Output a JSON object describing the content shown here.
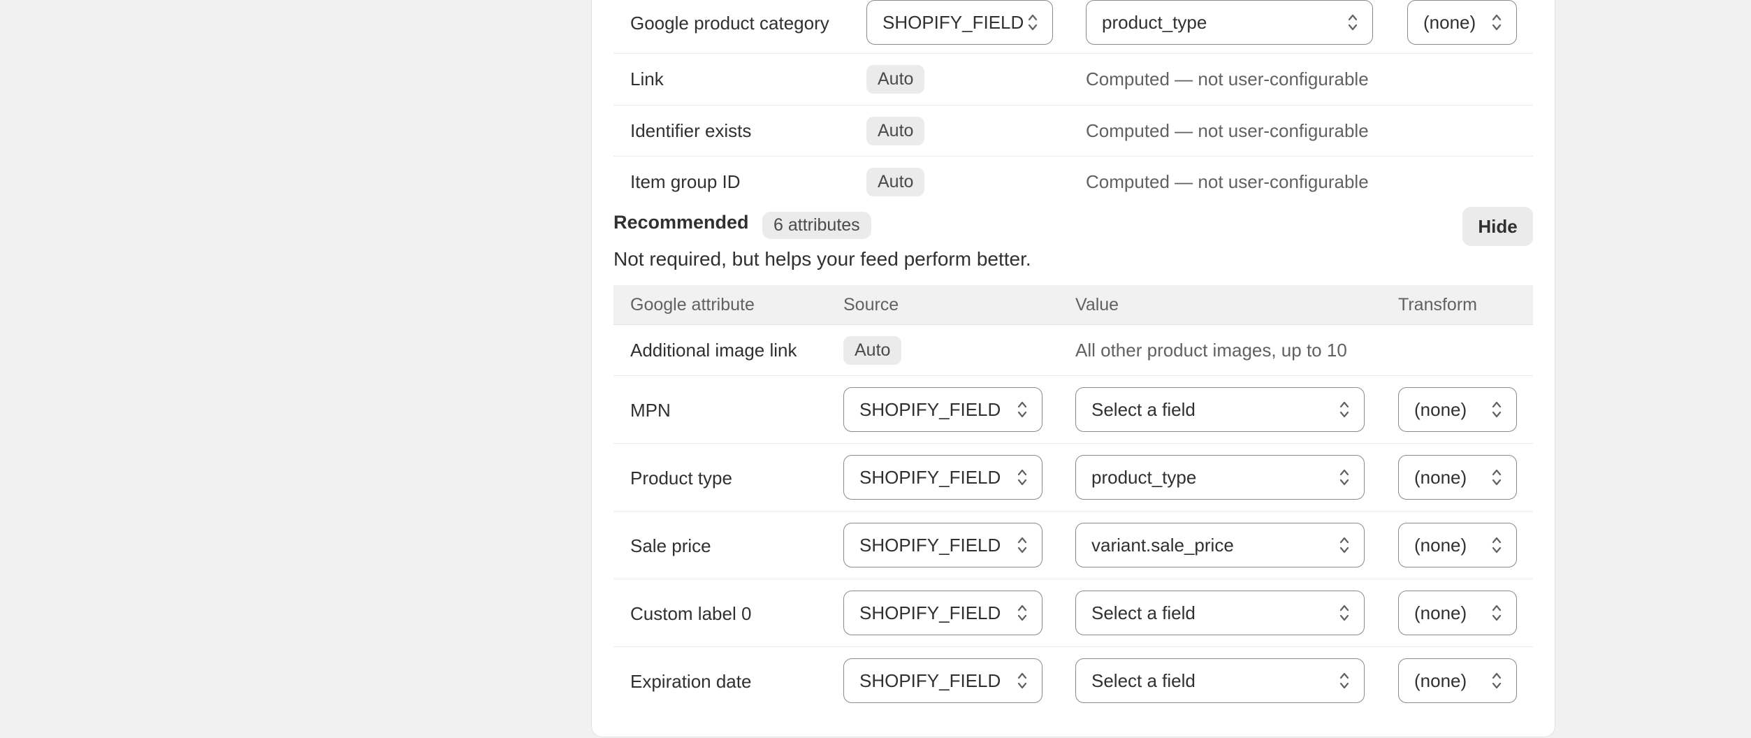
{
  "required_tail": [
    {
      "attribute": "Google product category",
      "source": "SHOPIFY_FIELD",
      "value": "product_type",
      "transform": "(none)"
    },
    {
      "attribute": "Link",
      "source_badge": "Auto",
      "note": "Computed — not user-configurable"
    },
    {
      "attribute": "Identifier exists",
      "source_badge": "Auto",
      "note": "Computed — not user-configurable"
    },
    {
      "attribute": "Item group ID",
      "source_badge": "Auto",
      "note": "Computed — not user-configurable"
    }
  ],
  "recommended": {
    "title": "Recommended",
    "count": "6 attributes",
    "hide_label": "Hide",
    "description": "Not required, but helps your feed perform better.",
    "columns": [
      "Google attribute",
      "Source",
      "Value",
      "Transform"
    ],
    "auto_row": {
      "attribute": "Additional image link",
      "source_badge": "Auto",
      "note": "All other product images, up to 10"
    },
    "rows": [
      {
        "attribute": "MPN",
        "source": "SHOPIFY_FIELD",
        "value": "Select a field",
        "transform": "(none)"
      },
      {
        "attribute": "Product type",
        "source": "SHOPIFY_FIELD",
        "value": "product_type",
        "transform": "(none)"
      },
      {
        "attribute": "Sale price",
        "source": "SHOPIFY_FIELD",
        "value": "variant.sale_price",
        "transform": "(none)"
      },
      {
        "attribute": "Custom label 0",
        "source": "SHOPIFY_FIELD",
        "value": "Select a field",
        "transform": "(none)"
      },
      {
        "attribute": "Expiration date",
        "source": "SHOPIFY_FIELD",
        "value": "Select a field",
        "transform": "(none)"
      }
    ]
  },
  "icons": {
    "select": "chevron-up-down-icon"
  },
  "colors": {
    "page_bg": "#f1f1f1",
    "card_bg": "#ffffff",
    "border": "#8a8a8a",
    "badge_bg": "#ebebeb",
    "muted_text": "#616161"
  }
}
